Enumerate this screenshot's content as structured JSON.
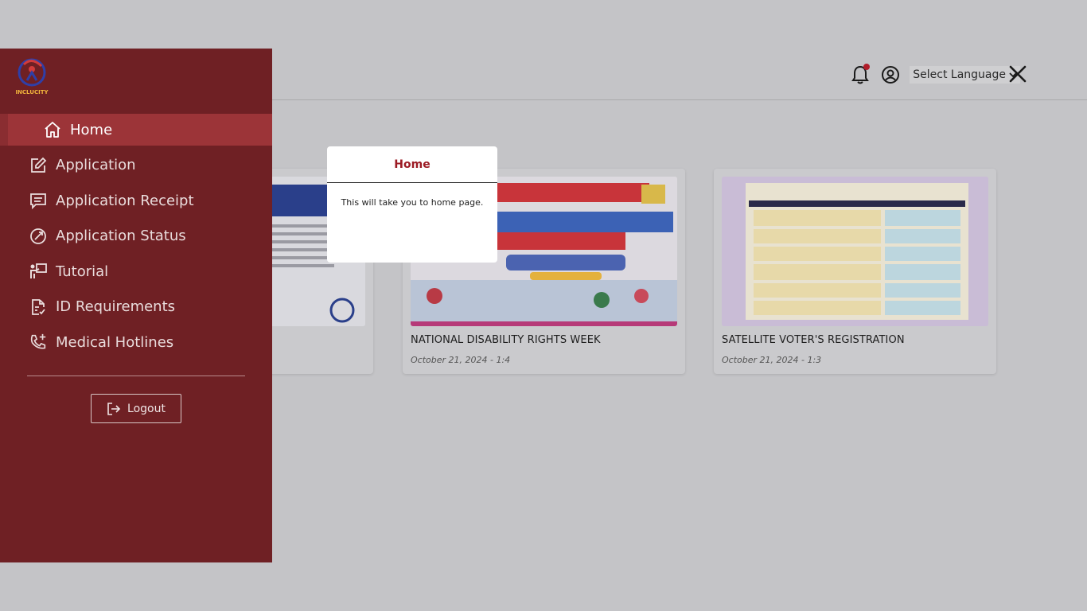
{
  "topbar": {
    "language_label": "Select Language",
    "icons": [
      "bell-icon",
      "user-circle-icon",
      "close-icon"
    ]
  },
  "sidebar": {
    "logo_text": "INCLUCITY",
    "items": [
      {
        "label": "Home",
        "icon": "home-icon",
        "active": true
      },
      {
        "label": "Application",
        "icon": "edit-icon"
      },
      {
        "label": "Application Receipt",
        "icon": "receipt-icon"
      },
      {
        "label": "Application Status",
        "icon": "status-icon"
      },
      {
        "label": "Tutorial",
        "icon": "presentation-icon"
      },
      {
        "label": "ID Requirements",
        "icon": "document-check-icon"
      },
      {
        "label": "Medical Hotlines",
        "icon": "phone-plus-icon"
      }
    ],
    "logout_label": "Logout"
  },
  "cards": [
    {
      "title": "",
      "meta": ""
    },
    {
      "title": "NATIONAL DISABILITY RIGHTS WEEK",
      "meta": "October 21, 2024 - 1:4"
    },
    {
      "title": "SATELLITE VOTER'S REGISTRATION",
      "meta": "October 21, 2024 - 1:3"
    }
  ],
  "popup": {
    "title": "Home",
    "body": "This will take you to home page."
  },
  "colors": {
    "sidebar": "#6f2024",
    "active_item": "#9c3438",
    "accent": "#9c1b24"
  }
}
